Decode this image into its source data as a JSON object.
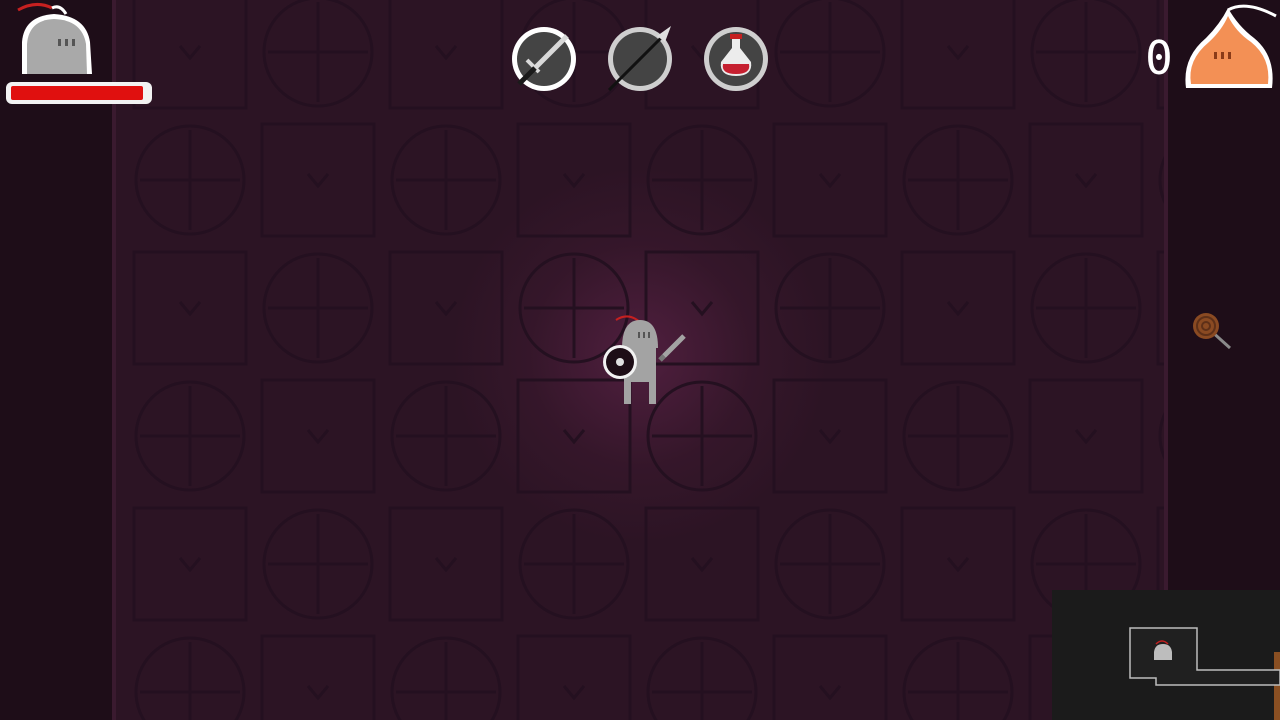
{
  "game": {
    "kill_count": "0",
    "player": {
      "health_fraction": 0.97
    },
    "weapon_slots": [
      {
        "item": "sword-icon",
        "selected": true
      },
      {
        "item": "spear-icon",
        "selected": false
      },
      {
        "item": "health-potion-icon",
        "selected": false
      }
    ],
    "enemy_icon": "orange-slime-icon",
    "pickup_icon": "lollipop-icon"
  },
  "colors": {
    "floor": "#2c1424",
    "wall": "#1e0d18",
    "health": "#e0100f",
    "slime": "#f39055",
    "knight": "#9d9d9d"
  }
}
